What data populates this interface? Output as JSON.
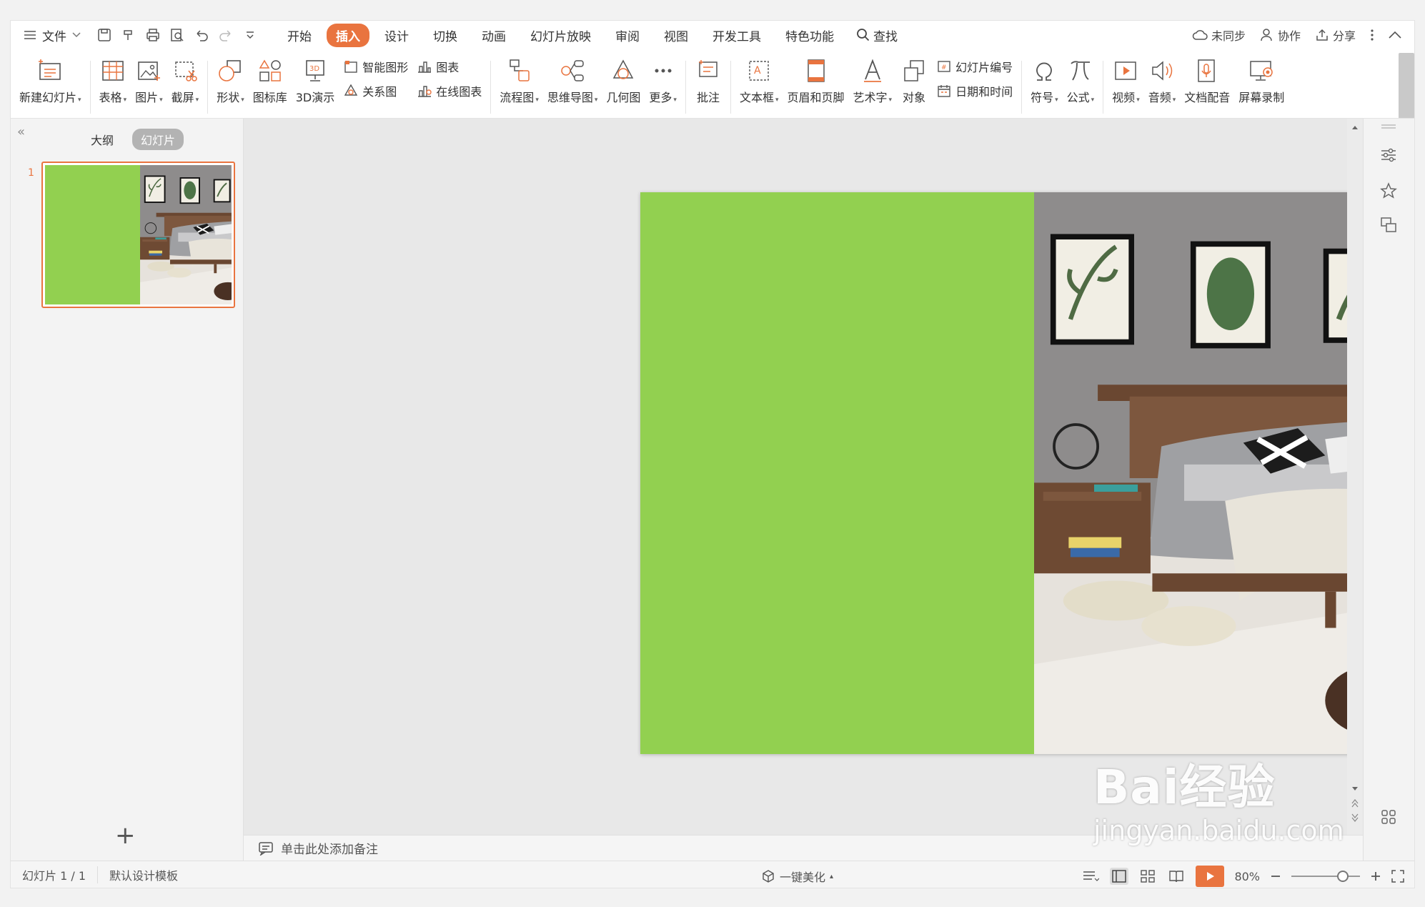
{
  "menubar": {
    "file_label": "文件",
    "tabs": [
      "开始",
      "插入",
      "设计",
      "切换",
      "动画",
      "幻灯片放映",
      "审阅",
      "视图",
      "开发工具",
      "特色功能"
    ],
    "find_label": "查找",
    "sync_label": "未同步",
    "collab_label": "协作",
    "share_label": "分享"
  },
  "ribbon": {
    "new_slide": "新建幻灯片",
    "table": "表格",
    "picture": "图片",
    "screenshot": "截屏",
    "shape": "形状",
    "icon_lib": "图标库",
    "demo3d": "3D演示",
    "smart_shape": "智能图形",
    "chart": "图表",
    "relation": "关系图",
    "online_chart": "在线图表",
    "flowchart": "流程图",
    "mindmap": "思维导图",
    "geometry": "几何图",
    "more": "更多",
    "comment": "批注",
    "textbox": "文本框",
    "header_footer": "页眉和页脚",
    "wordart": "艺术字",
    "object": "对象",
    "slide_number": "幻灯片编号",
    "datetime": "日期和时间",
    "symbol": "符号",
    "formula": "公式",
    "video": "视频",
    "audio": "音频",
    "doc_dub": "文档配音",
    "screen_record": "屏幕录制"
  },
  "panel": {
    "tab_outline": "大纲",
    "tab_slides": "幻灯片",
    "slide_number": "1"
  },
  "notes": {
    "placeholder": "单击此处添加备注"
  },
  "status": {
    "slide_info": "幻灯片 1 / 1",
    "template": "默认设计模板",
    "beautify": "一键美化",
    "zoom": "80%"
  },
  "slide": {
    "left_color": "#92d050"
  },
  "accent": "#e9743f",
  "watermark": {
    "line1": "Bai经验",
    "line2": "jingyan.baidu.com"
  }
}
